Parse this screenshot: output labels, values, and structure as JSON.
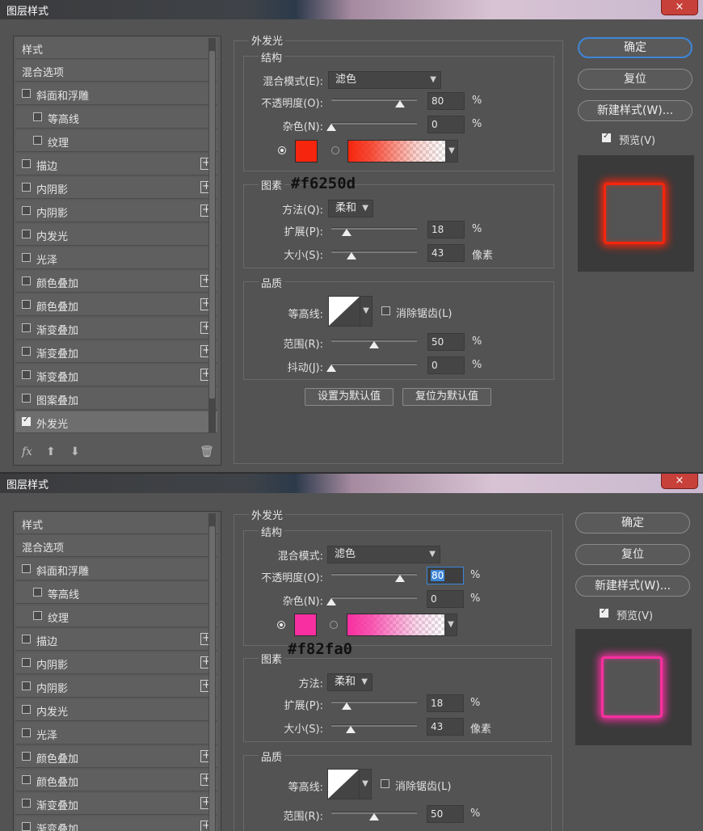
{
  "dialogs": [
    {
      "title": "图层样式",
      "close": "×",
      "styles_header": "样式",
      "blend_options": "混合选项",
      "items": [
        {
          "label": "斜面和浮雕",
          "checked": false,
          "plus": false,
          "indent": false
        },
        {
          "label": "等高线",
          "checked": false,
          "plus": false,
          "indent": true
        },
        {
          "label": "纹理",
          "checked": false,
          "plus": false,
          "indent": true
        },
        {
          "label": "描边",
          "checked": false,
          "plus": true,
          "indent": false
        },
        {
          "label": "内阴影",
          "checked": false,
          "plus": true,
          "indent": false
        },
        {
          "label": "内阴影",
          "checked": false,
          "plus": true,
          "indent": false
        },
        {
          "label": "内发光",
          "checked": false,
          "plus": false,
          "indent": false
        },
        {
          "label": "光泽",
          "checked": false,
          "plus": false,
          "indent": false
        },
        {
          "label": "颜色叠加",
          "checked": false,
          "plus": true,
          "indent": false
        },
        {
          "label": "颜色叠加",
          "checked": false,
          "plus": true,
          "indent": false
        },
        {
          "label": "渐变叠加",
          "checked": false,
          "plus": true,
          "indent": false
        },
        {
          "label": "渐变叠加",
          "checked": false,
          "plus": true,
          "indent": false
        },
        {
          "label": "渐变叠加",
          "checked": false,
          "plus": true,
          "indent": false
        },
        {
          "label": "图案叠加",
          "checked": false,
          "plus": false,
          "indent": false
        },
        {
          "label": "外发光",
          "checked": true,
          "plus": false,
          "indent": false,
          "selected": true
        }
      ],
      "footer_fx": "fx",
      "section_title": "外发光",
      "structure": {
        "legend": "结构",
        "blend_mode_label": "混合模式(E):",
        "blend_mode_value": "滤色",
        "opacity_label": "不透明度(O):",
        "opacity_value": "80",
        "opacity_pct": 80,
        "noise_label": "杂色(N):",
        "noise_value": "0",
        "noise_pct": 0,
        "unit_pct": "%"
      },
      "glow_color": "#f6250d",
      "annotation": "#f6250d",
      "elements": {
        "legend": "图素",
        "technique_label": "方法(Q):",
        "technique_value": "柔和",
        "spread_label": "扩展(P):",
        "spread_value": "18",
        "spread_pct": 18,
        "size_label": "大小(S):",
        "size_value": "43",
        "size_unit": "像素"
      },
      "quality": {
        "legend": "品质",
        "contour_label": "等高线:",
        "antialias_label": "消除锯齿(L)",
        "range_label": "范围(R):",
        "range_value": "50",
        "range_pct": 50,
        "jitter_label": "抖动(J):",
        "jitter_value": "0",
        "jitter_pct": 0
      },
      "set_default": "设置为默认值",
      "reset_default": "复位为默认值",
      "buttons": {
        "ok": "确定",
        "reset": "复位",
        "new_style": "新建样式(W)...",
        "preview": "预览(V)"
      }
    },
    {
      "title": "图层样式",
      "close": "×",
      "styles_header": "样式",
      "blend_options": "混合选项",
      "items": [
        {
          "label": "斜面和浮雕",
          "checked": false,
          "plus": false,
          "indent": false
        },
        {
          "label": "等高线",
          "checked": false,
          "plus": false,
          "indent": true
        },
        {
          "label": "纹理",
          "checked": false,
          "plus": false,
          "indent": true
        },
        {
          "label": "描边",
          "checked": false,
          "plus": true,
          "indent": false
        },
        {
          "label": "内阴影",
          "checked": false,
          "plus": true,
          "indent": false
        },
        {
          "label": "内阴影",
          "checked": false,
          "plus": true,
          "indent": false
        },
        {
          "label": "内发光",
          "checked": false,
          "plus": false,
          "indent": false
        },
        {
          "label": "光泽",
          "checked": false,
          "plus": false,
          "indent": false
        },
        {
          "label": "颜色叠加",
          "checked": false,
          "plus": true,
          "indent": false
        },
        {
          "label": "颜色叠加",
          "checked": false,
          "plus": true,
          "indent": false
        },
        {
          "label": "渐变叠加",
          "checked": false,
          "plus": true,
          "indent": false
        },
        {
          "label": "渐变叠加",
          "checked": false,
          "plus": true,
          "indent": false
        }
      ],
      "section_title": "外发光",
      "structure": {
        "legend": "结构",
        "blend_mode_label": "混合模式:",
        "blend_mode_value": "滤色",
        "opacity_label": "不透明度(O):",
        "opacity_value": "80",
        "opacity_pct": 80,
        "noise_label": "杂色(N):",
        "noise_value": "0",
        "noise_pct": 0,
        "unit_pct": "%"
      },
      "glow_color": "#f82fa0",
      "annotation": "#f82fa0",
      "elements": {
        "legend": "图素",
        "technique_label": "方法:",
        "technique_value": "柔和",
        "spread_label": "扩展(P):",
        "spread_value": "18",
        "spread_pct": 18,
        "size_label": "大小(S):",
        "size_value": "43",
        "size_unit": "像素"
      },
      "quality": {
        "legend": "品质",
        "contour_label": "等高线:",
        "antialias_label": "消除锯齿(L)",
        "range_label": "范围(R):",
        "range_value": "50",
        "range_pct": 50
      },
      "buttons": {
        "ok": "确定",
        "reset": "复位",
        "new_style": "新建样式(W)...",
        "preview": "预览(V)"
      }
    }
  ]
}
